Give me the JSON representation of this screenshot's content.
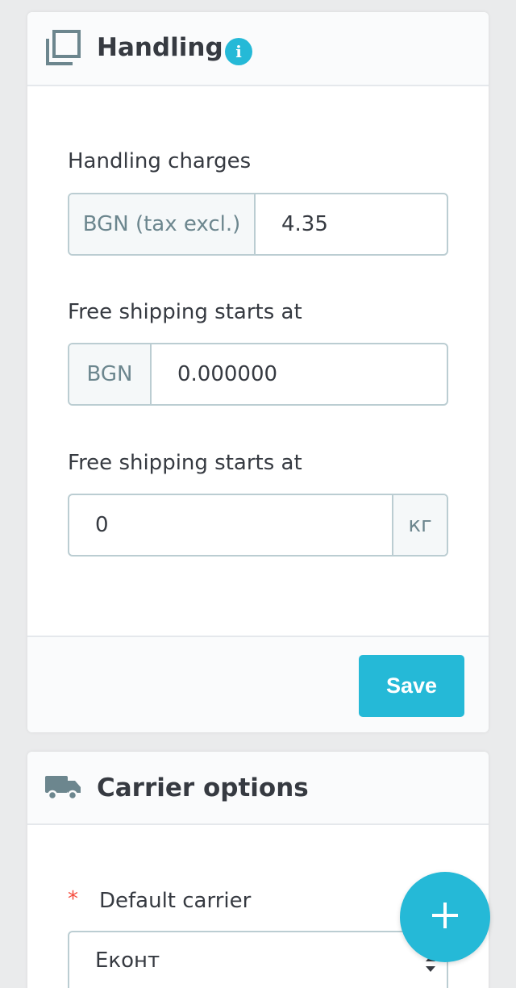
{
  "handling": {
    "title": "Handling",
    "handling_charges": {
      "label": "Handling charges",
      "addon": "BGN (tax excl.)",
      "value": "4.35"
    },
    "free_shipping_price": {
      "label": "Free shipping starts at",
      "addon": "BGN",
      "value": "0.000000"
    },
    "free_shipping_weight": {
      "label": "Free shipping starts at",
      "value": "0",
      "addon": "кг"
    },
    "save_label": "Save"
  },
  "carrier_options": {
    "title": "Carrier options",
    "default_carrier": {
      "required_mark": "*",
      "label": "Default carrier",
      "selected": "Еконт"
    }
  },
  "icons": {
    "handling": "layers-icon",
    "info": "info-icon",
    "carrier": "truck-icon",
    "fab": "plus-icon",
    "select": "sort-arrows-icon"
  },
  "colors": {
    "accent": "#25b9d7",
    "required": "#f54c3e",
    "border": "#bbcdd2",
    "text": "#363a41"
  }
}
